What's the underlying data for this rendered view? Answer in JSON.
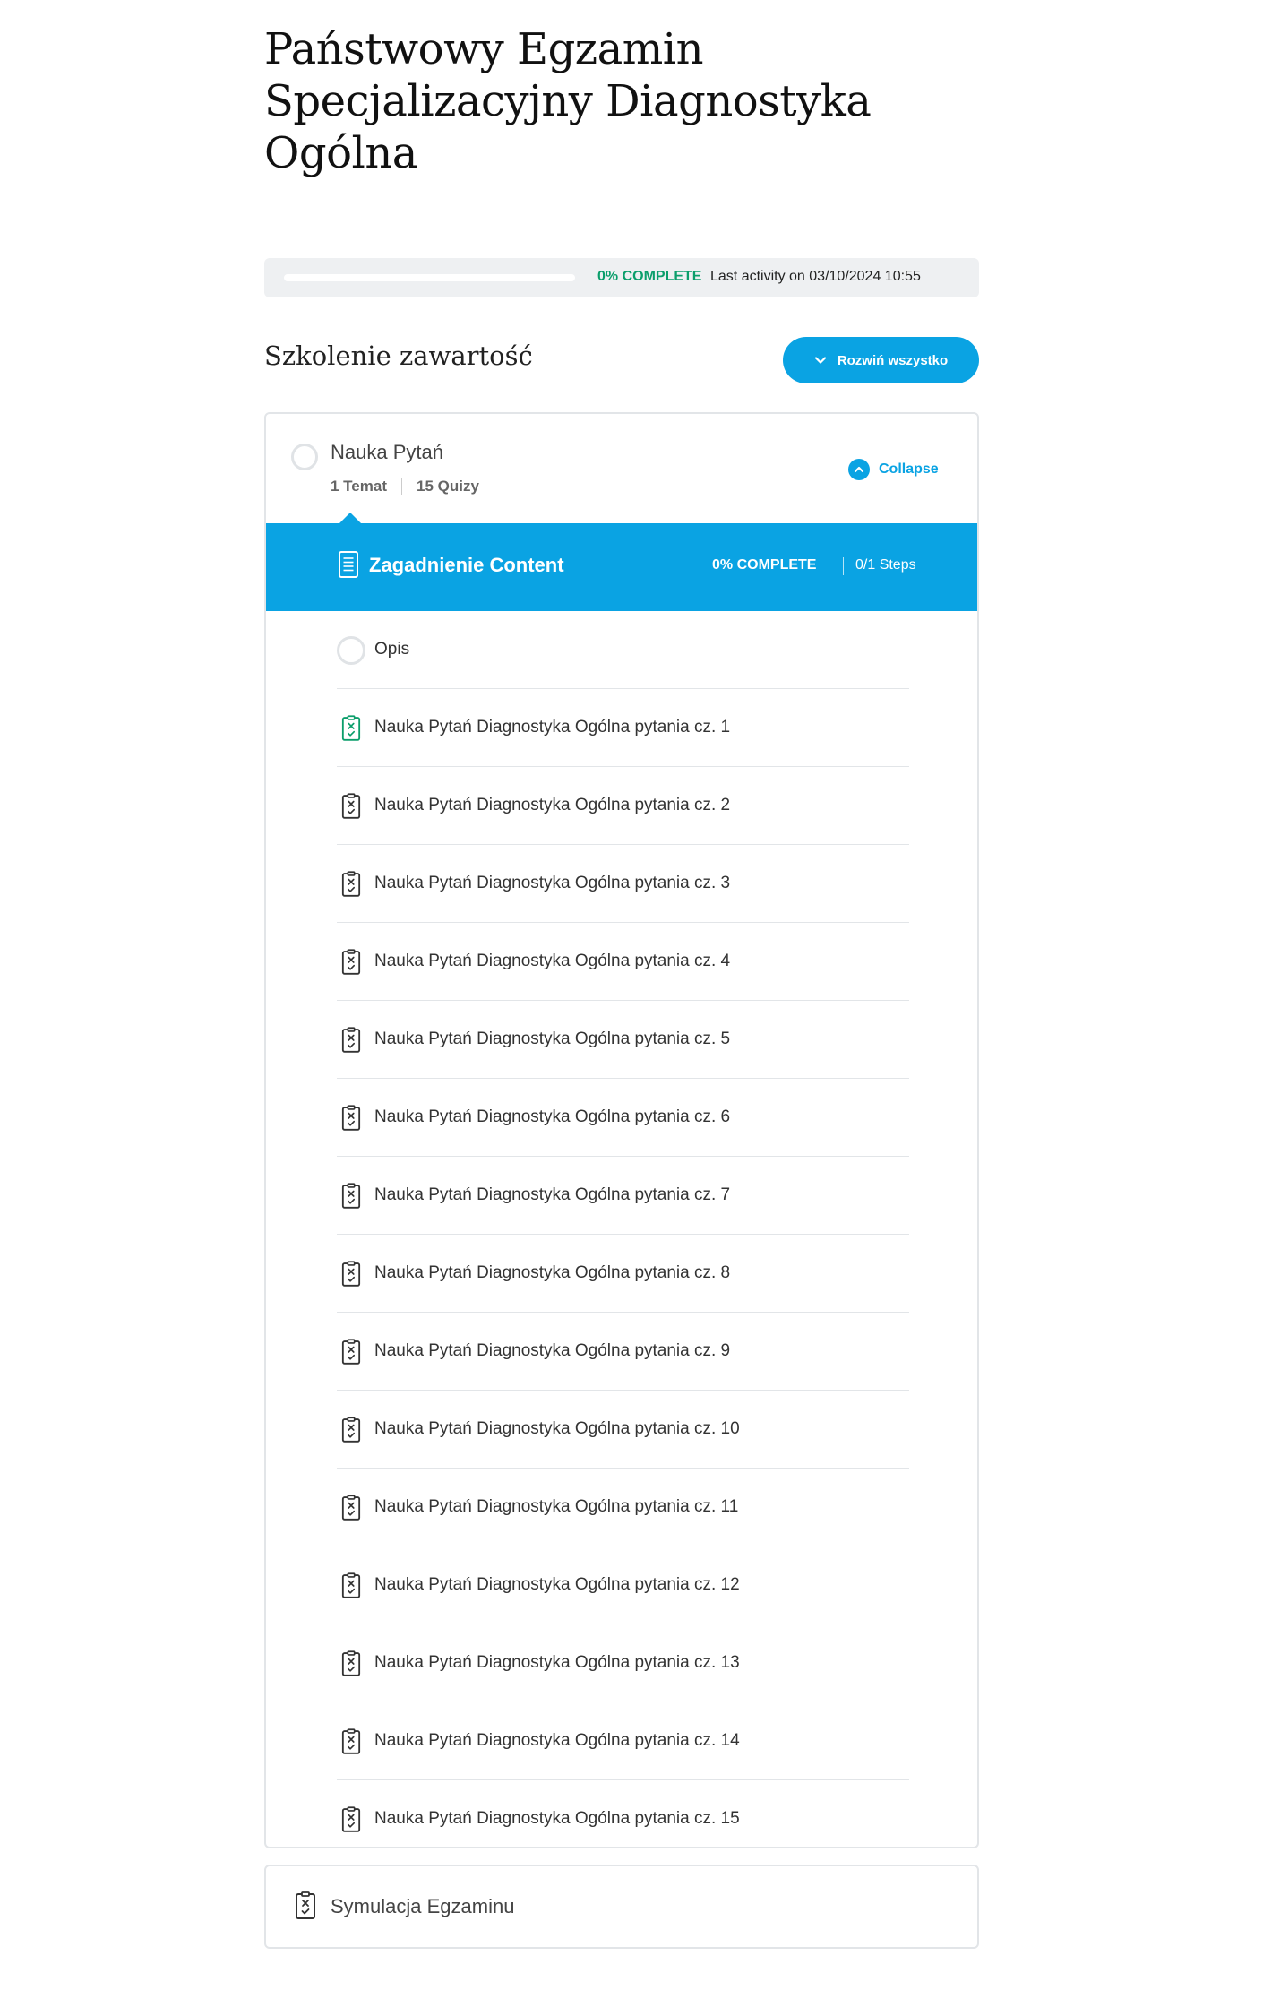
{
  "course": {
    "title": "Państwowy Egzamin Specjalizacyjny Diagnostyka Ogólna"
  },
  "progress": {
    "percent": 0,
    "label": "0% COMPLETE",
    "last_activity": "Last activity on 03/10/2024 10:55",
    "color": "#0b9e6b"
  },
  "content": {
    "heading": "Szkolenie zawartość",
    "expand_all_label": "Rozwiń wszystko",
    "accent_color": "#0aa3e3"
  },
  "lesson": {
    "title": "Nauka Pytań",
    "topics_count": "1 Temat",
    "quizzes_count": "15 Quizy",
    "collapse_label": "Collapse",
    "topic": {
      "title": "Zagadnienie Content",
      "progress_label": "0% COMPLETE",
      "steps_label": "0/1 Steps"
    },
    "steps": [
      {
        "label": "Opis",
        "icon": "circle-icon"
      },
      {
        "label": "Nauka Pytań Diagnostyka Ogólna pytania cz. 1",
        "icon": "quiz-icon",
        "highlight": true
      },
      {
        "label": "Nauka Pytań Diagnostyka Ogólna pytania cz. 2",
        "icon": "quiz-icon"
      },
      {
        "label": "Nauka Pytań Diagnostyka Ogólna pytania cz. 3",
        "icon": "quiz-icon"
      },
      {
        "label": "Nauka Pytań Diagnostyka Ogólna pytania cz. 4",
        "icon": "quiz-icon"
      },
      {
        "label": "Nauka Pytań Diagnostyka Ogólna pytania cz. 5",
        "icon": "quiz-icon"
      },
      {
        "label": "Nauka Pytań Diagnostyka Ogólna pytania cz. 6",
        "icon": "quiz-icon"
      },
      {
        "label": "Nauka Pytań Diagnostyka Ogólna pytania cz. 7",
        "icon": "quiz-icon"
      },
      {
        "label": "Nauka Pytań Diagnostyka Ogólna pytania cz. 8",
        "icon": "quiz-icon"
      },
      {
        "label": "Nauka Pytań Diagnostyka Ogólna pytania cz. 9",
        "icon": "quiz-icon"
      },
      {
        "label": "Nauka Pytań Diagnostyka Ogólna pytania cz. 10",
        "icon": "quiz-icon"
      },
      {
        "label": "Nauka Pytań Diagnostyka Ogólna pytania cz. 11",
        "icon": "quiz-icon"
      },
      {
        "label": "Nauka Pytań Diagnostyka Ogólna pytania cz. 12",
        "icon": "quiz-icon"
      },
      {
        "label": "Nauka Pytań Diagnostyka Ogólna pytania cz. 13",
        "icon": "quiz-icon"
      },
      {
        "label": "Nauka Pytań Diagnostyka Ogólna pytania cz. 14",
        "icon": "quiz-icon"
      },
      {
        "label": "Nauka Pytań Diagnostyka Ogólna pytania cz. 15",
        "icon": "quiz-icon"
      }
    ]
  },
  "exam": {
    "title": "Symulacja Egzaminu",
    "icon": "quiz-icon"
  }
}
